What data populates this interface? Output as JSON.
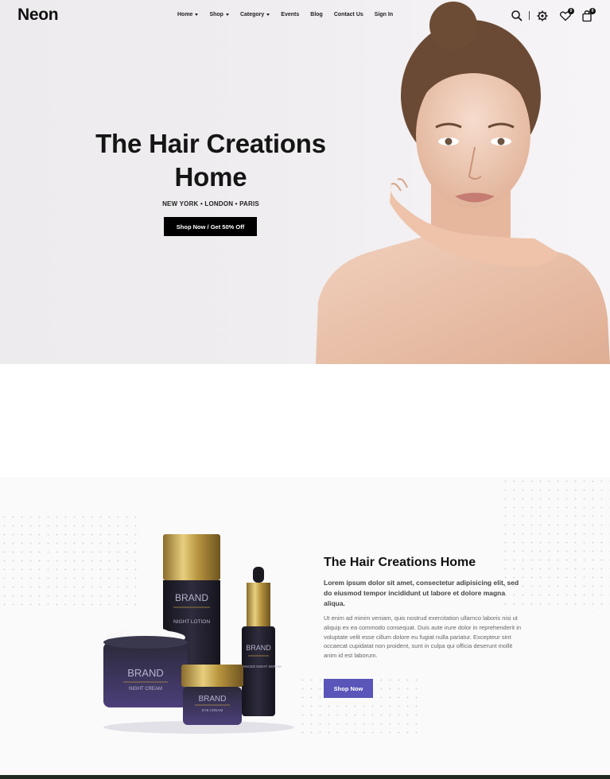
{
  "nav": {
    "logo": "Neon",
    "menu": [
      {
        "label": "Home",
        "has_dropdown": true
      },
      {
        "label": "Shop",
        "has_dropdown": true
      },
      {
        "label": "Category",
        "has_dropdown": true
      },
      {
        "label": "Events",
        "has_dropdown": false
      },
      {
        "label": "Blog",
        "has_dropdown": false
      },
      {
        "label": "Contact Us",
        "has_dropdown": false
      },
      {
        "label": "Sign In",
        "has_dropdown": false
      }
    ],
    "icons": {
      "search": "search-icon",
      "settings": "gear-icon",
      "wishlist": "heart-icon",
      "cart": "shopping-bag-icon"
    },
    "wishlist_count": "0",
    "cart_count": "0"
  },
  "hero": {
    "title": "The Hair Creations Home",
    "subtitle": "NEW YORK • LONDON • PARIS",
    "button_label": "Shop Now / Get 50% Off"
  },
  "products": {
    "items": [
      {
        "brand": "BRAND",
        "name": "NIGHT LOTION"
      },
      {
        "brand": "BRAND",
        "name": "NIGHT CREAM"
      },
      {
        "brand": "BRAND",
        "name": "EYE CREAM"
      },
      {
        "brand": "BRAND",
        "name": "ADVANCED NIGHT SERUM"
      }
    ]
  },
  "feature": {
    "title": "The Hair Creations Home",
    "lead": "Lorem ipsum dolor sit amet, consectetur adipisicing elit, sed do eiusmod tempor incididunt ut labore et dolore magna aliqua.",
    "body": "Ut enim ad minim veniam, quis nostrud exercitation ullamco laboris nisi ut aliquip ex ea commodo consequat. Duis aute irure dolor in reprehenderit in voluptate velit esse cillum dolore eu fugiat nulla pariatur. Excepteur sint occaecat cupidatat non proident, sunt in culpa qui officia deserunt mollit anim id est laborum.",
    "button_label": "Shop Now"
  },
  "colors": {
    "accent": "#5a55b8",
    "dark": "#000000",
    "hero_bg": "#efedef"
  }
}
